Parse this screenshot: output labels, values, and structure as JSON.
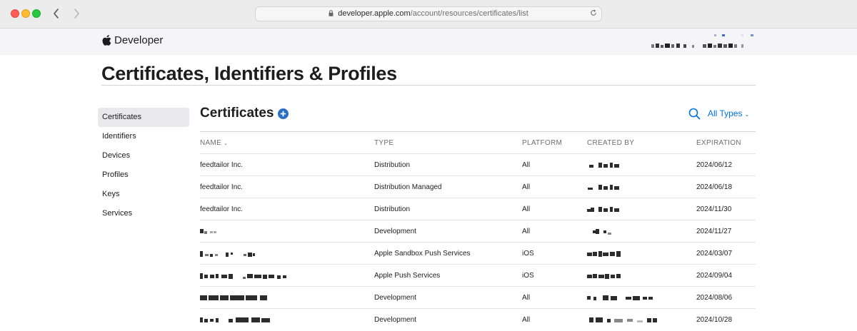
{
  "browser": {
    "url_host": "developer.apple.com",
    "url_path": "/account/resources/certificates/list",
    "back_icon": "chevron-left-icon",
    "forward_icon": "chevron-right-icon"
  },
  "header": {
    "brand": "Developer"
  },
  "page": {
    "title": "Certificates, Identifiers & Profiles"
  },
  "sidebar": {
    "items": [
      {
        "label": "Certificates",
        "active": true
      },
      {
        "label": "Identifiers"
      },
      {
        "label": "Devices"
      },
      {
        "label": "Profiles"
      },
      {
        "label": "Keys"
      },
      {
        "label": "Services"
      }
    ]
  },
  "main": {
    "section_title": "Certificates",
    "filter_label": "All Types",
    "columns": {
      "name": "NAME",
      "type": "TYPE",
      "platform": "PLATFORM",
      "created_by": "CREATED BY",
      "expiration": "EXPIRATION"
    },
    "rows": [
      {
        "name": "feedtailor Inc.",
        "type": "Distribution",
        "platform": "All",
        "expiration": "2024/06/12"
      },
      {
        "name": "feedtailor Inc.",
        "type": "Distribution Managed",
        "platform": "All",
        "expiration": "2024/06/18"
      },
      {
        "name": "feedtailor Inc.",
        "type": "Distribution",
        "platform": "All",
        "expiration": "2024/11/30"
      },
      {
        "name": "",
        "type": "Development",
        "platform": "All",
        "expiration": "2024/11/27"
      },
      {
        "name": "",
        "type": "Apple Sandbox Push Services",
        "platform": "iOS",
        "expiration": "2024/03/07"
      },
      {
        "name": "",
        "type": "Apple Push Services",
        "platform": "iOS",
        "expiration": "2024/09/04"
      },
      {
        "name": "",
        "type": "Development",
        "platform": "All",
        "expiration": "2024/08/06"
      },
      {
        "name": "",
        "type": "Development",
        "platform": "All",
        "expiration": "2024/10/28"
      }
    ]
  },
  "colors": {
    "accent": "#0071e3",
    "header_bg": "#f5f5f7",
    "active_bg": "#e8e8ed"
  }
}
